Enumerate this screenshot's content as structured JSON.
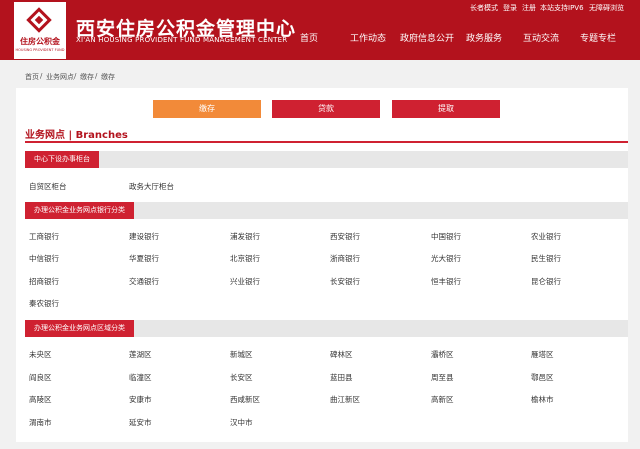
{
  "header": {
    "logo_cn": "住房公积金",
    "logo_en": "HOUSING PROVIDENT FUND",
    "title": "西安住房公积金管理中心",
    "subtitle": "XI'AN HOUSING PROVIDENT FUND MANAGEMENT CENTER",
    "util_links": [
      "长者模式",
      "登录",
      "注册",
      "本站支持IPV6",
      "无障碍浏览"
    ],
    "nav": [
      "首页",
      "工作动态",
      "政府信息公开",
      "政务服务",
      "互动交流",
      "专题专栏"
    ],
    "brand_color": "#b3121d"
  },
  "breadcrumb": [
    "首页",
    "/",
    "业务网点",
    "/",
    "缴存",
    "/",
    "缴存"
  ],
  "tabs": [
    {
      "label": "缴存",
      "active": true
    },
    {
      "label": "贷款",
      "active": false
    },
    {
      "label": "提取",
      "active": false
    }
  ],
  "branches_title": "业务网点 | Branches",
  "sections": [
    {
      "title": "中心下设办事柜台",
      "items": [
        "自贸区柜台",
        "政务大厅柜台"
      ]
    },
    {
      "title": "办理公积金业务网点银行分类",
      "items": [
        "工商银行",
        "建设银行",
        "浦发银行",
        "西安银行",
        "中国银行",
        "农业银行",
        "中信银行",
        "华夏银行",
        "北京银行",
        "浙商银行",
        "光大银行",
        "民生银行",
        "招商银行",
        "交通银行",
        "兴业银行",
        "长安银行",
        "恒丰银行",
        "昆仑银行",
        "秦农银行"
      ]
    },
    {
      "title": "办理公积金业务网点区域分类",
      "items": [
        "未央区",
        "莲湖区",
        "新城区",
        "碑林区",
        "灞桥区",
        "雁塔区",
        "阎良区",
        "临潼区",
        "长安区",
        "蓝田县",
        "周至县",
        "鄠邑区",
        "高陵区",
        "安康市",
        "西咸新区",
        "曲江新区",
        "高新区",
        "榆林市",
        "渭南市",
        "延安市",
        "汉中市"
      ]
    }
  ],
  "colors": {
    "accent": "#cf2131",
    "active_tab": "#f28a39",
    "section_bg": "#e7e7e7",
    "page_bg": "#f1f1f1"
  }
}
